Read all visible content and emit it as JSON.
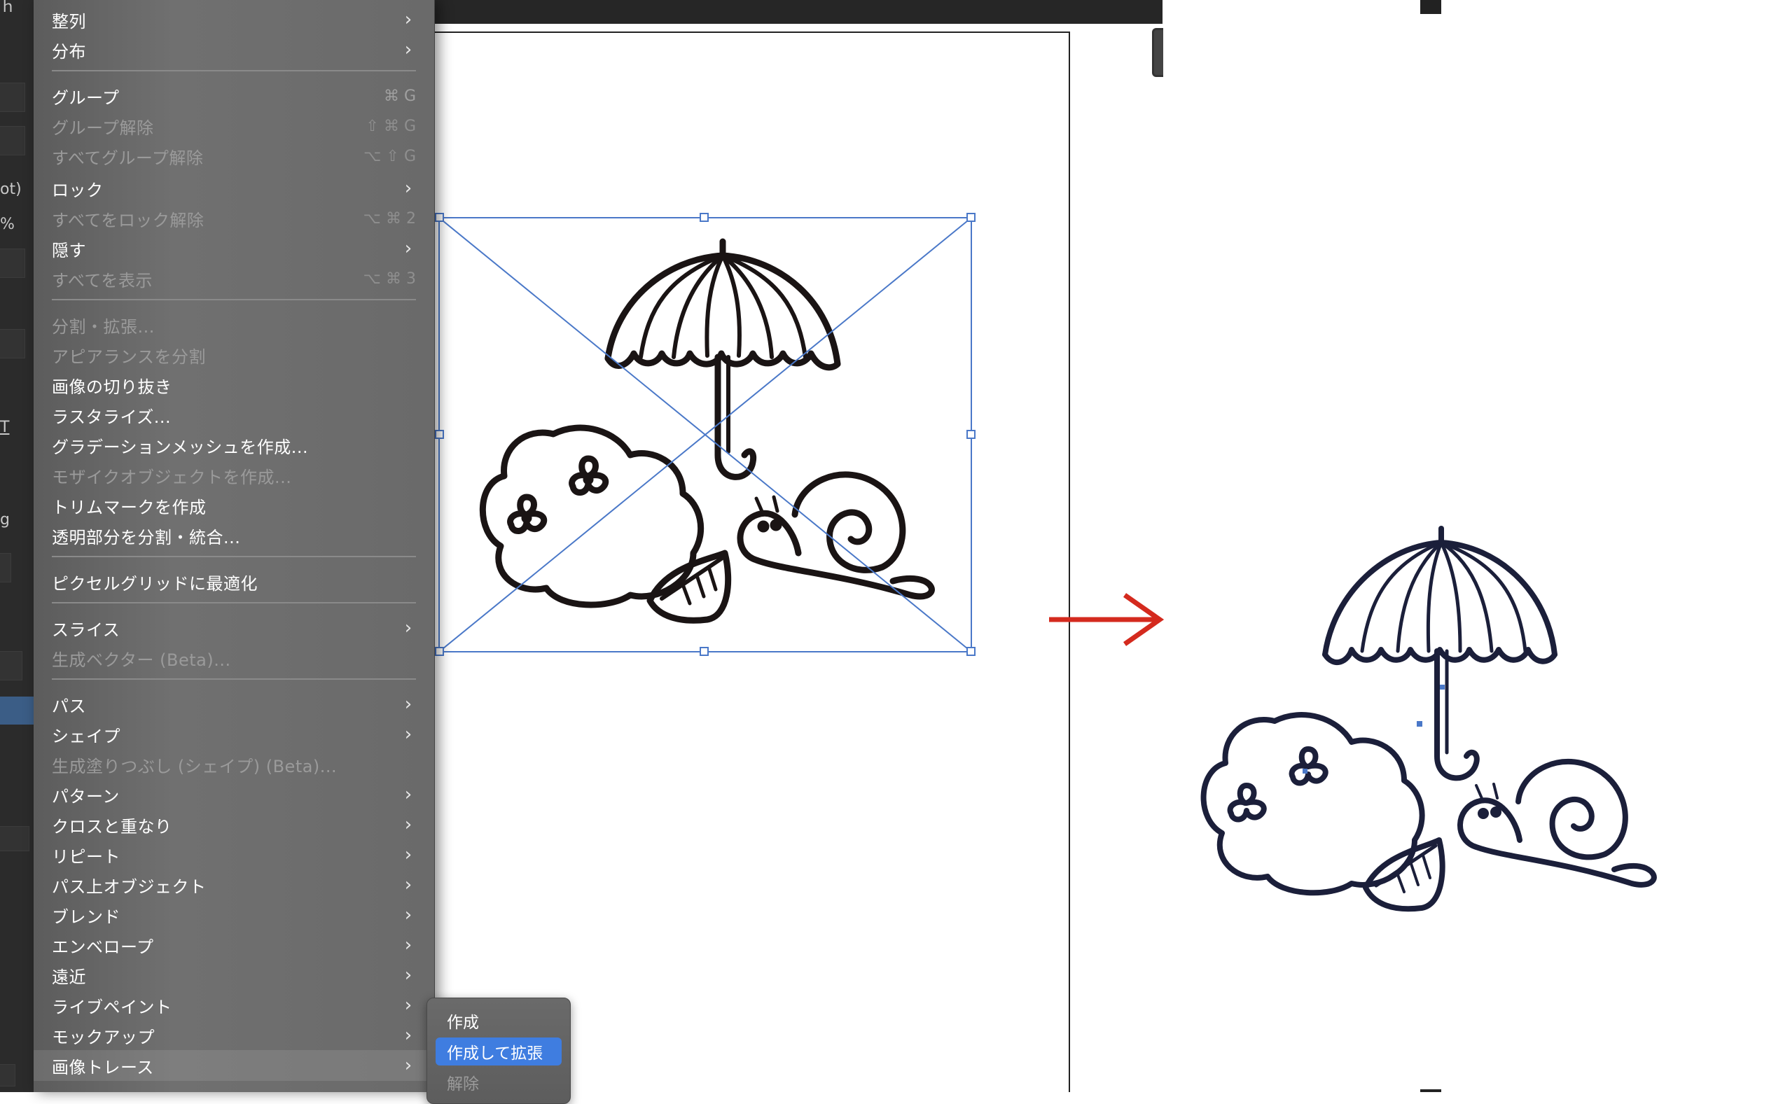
{
  "left_panel": {
    "fragments": [
      "ｈ",
      "ot)",
      "%",
      "T",
      "g"
    ]
  },
  "menu": {
    "items": [
      {
        "label": "整列",
        "shortcut": "",
        "submenu": true,
        "disabled": false
      },
      {
        "label": "分布",
        "shortcut": "",
        "submenu": true,
        "disabled": false
      },
      {
        "label": "グループ",
        "shortcut": "⌘ G",
        "submenu": false,
        "disabled": false
      },
      {
        "label": "グループ解除",
        "shortcut": "⇧ ⌘ G",
        "submenu": false,
        "disabled": true
      },
      {
        "label": "すべてグループ解除",
        "shortcut": "⌥ ⇧ G",
        "submenu": false,
        "disabled": true
      },
      {
        "label": "ロック",
        "shortcut": "",
        "submenu": true,
        "disabled": false
      },
      {
        "label": "すべてをロック解除",
        "shortcut": "⌥ ⌘ 2",
        "submenu": false,
        "disabled": true
      },
      {
        "label": "隠す",
        "shortcut": "",
        "submenu": true,
        "disabled": false
      },
      {
        "label": "すべてを表示",
        "shortcut": "⌥ ⌘ 3",
        "submenu": false,
        "disabled": true
      },
      {
        "label": "分割・拡張...",
        "shortcut": "",
        "submenu": false,
        "disabled": true
      },
      {
        "label": "アピアランスを分割",
        "shortcut": "",
        "submenu": false,
        "disabled": true
      },
      {
        "label": "画像の切り抜き",
        "shortcut": "",
        "submenu": false,
        "disabled": false
      },
      {
        "label": "ラスタライズ...",
        "shortcut": "",
        "submenu": false,
        "disabled": false
      },
      {
        "label": "グラデーションメッシュを作成...",
        "shortcut": "",
        "submenu": false,
        "disabled": false
      },
      {
        "label": "モザイクオブジェクトを作成...",
        "shortcut": "",
        "submenu": false,
        "disabled": true
      },
      {
        "label": "トリムマークを作成",
        "shortcut": "",
        "submenu": false,
        "disabled": false
      },
      {
        "label": "透明部分を分割・統合...",
        "shortcut": "",
        "submenu": false,
        "disabled": false
      },
      {
        "label": "ピクセルグリッドに最適化",
        "shortcut": "",
        "submenu": false,
        "disabled": false
      },
      {
        "label": "スライス",
        "shortcut": "",
        "submenu": true,
        "disabled": false
      },
      {
        "label": "生成ベクター (Beta)...",
        "shortcut": "",
        "submenu": false,
        "disabled": true
      },
      {
        "label": "パス",
        "shortcut": "",
        "submenu": true,
        "disabled": false
      },
      {
        "label": "シェイプ",
        "shortcut": "",
        "submenu": true,
        "disabled": false
      },
      {
        "label": "生成塗りつぶし (シェイプ) (Beta)...",
        "shortcut": "",
        "submenu": false,
        "disabled": true
      },
      {
        "label": "パターン",
        "shortcut": "",
        "submenu": true,
        "disabled": false
      },
      {
        "label": "クロスと重なり",
        "shortcut": "",
        "submenu": true,
        "disabled": false
      },
      {
        "label": "リピート",
        "shortcut": "",
        "submenu": true,
        "disabled": false
      },
      {
        "label": "パス上オブジェクト",
        "shortcut": "",
        "submenu": true,
        "disabled": false
      },
      {
        "label": "ブレンド",
        "shortcut": "",
        "submenu": true,
        "disabled": false
      },
      {
        "label": "エンベロープ",
        "shortcut": "",
        "submenu": true,
        "disabled": false
      },
      {
        "label": "遠近",
        "shortcut": "",
        "submenu": true,
        "disabled": false
      },
      {
        "label": "ライブペイント",
        "shortcut": "",
        "submenu": true,
        "disabled": false
      },
      {
        "label": "モックアップ",
        "shortcut": "",
        "submenu": true,
        "disabled": false
      },
      {
        "label": "画像トレース",
        "shortcut": "",
        "submenu": true,
        "disabled": false,
        "highlighted": true
      }
    ],
    "chevron": "›"
  },
  "submenu": {
    "items": [
      {
        "label": "作成",
        "active": false,
        "disabled": false
      },
      {
        "label": "作成して拡張",
        "active": true,
        "disabled": false
      },
      {
        "label": "解除",
        "active": false,
        "disabled": true
      }
    ]
  },
  "colors": {
    "selection_blue": "#4a78c8",
    "arrow_red": "#d42a1e",
    "traced_stroke": "#1b1f3a",
    "raster_stroke": "#1a1414",
    "highlight_blue": "#3f7de0"
  },
  "icons": {
    "arrow": "right-arrow-icon",
    "submenu": "chevron-right-icon"
  }
}
